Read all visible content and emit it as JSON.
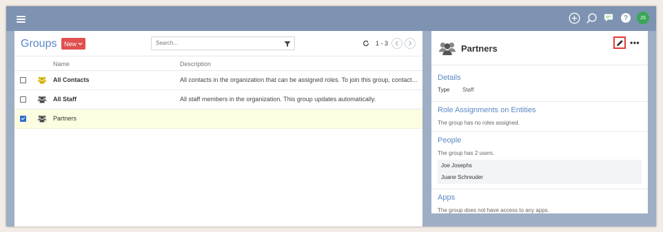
{
  "topbar": {
    "icons": [
      "menu-icon",
      "add-icon",
      "search-icon",
      "chat-icon",
      "help-icon"
    ],
    "help_label": "?",
    "avatar_initials": "JS"
  },
  "groups": {
    "title": "Groups",
    "new_label": "New",
    "search_placeholder": "Search...",
    "pagination": "1 - 3",
    "columns": [
      "Name",
      "Description"
    ],
    "rows": [
      {
        "name": "All Contacts",
        "description": "All contacts in the organization that can be assigned roles. To join this group, contacts must h...",
        "checked": false,
        "icon_color": "#e0c21a"
      },
      {
        "name": "All Staff",
        "description": "All staff members in the organization. This group updates automatically.",
        "checked": false,
        "icon_color": "#555555"
      },
      {
        "name": "Partners",
        "description": "",
        "checked": true,
        "icon_color": "#555555"
      }
    ]
  },
  "details": {
    "title": "Partners",
    "details_heading": "Details",
    "type_label": "Type",
    "type_value": "Staff",
    "roles_heading": "Role Assignments on Entities",
    "roles_text": "The group has no roles assigned.",
    "people_heading": "People",
    "people_text": "The group has 2 users.",
    "users": [
      "Joe Josephs",
      "Juane Schreuder"
    ],
    "apps_heading": "Apps",
    "apps_text": "The group does not have access to any apps."
  },
  "colors": {
    "topbar": "#7d93b1",
    "accent": "#5b86c5",
    "new_button": "#e05050",
    "selected_row": "#fdfde1",
    "edit_highlight": "#e23b2e",
    "avatar": "#3aa757"
  }
}
